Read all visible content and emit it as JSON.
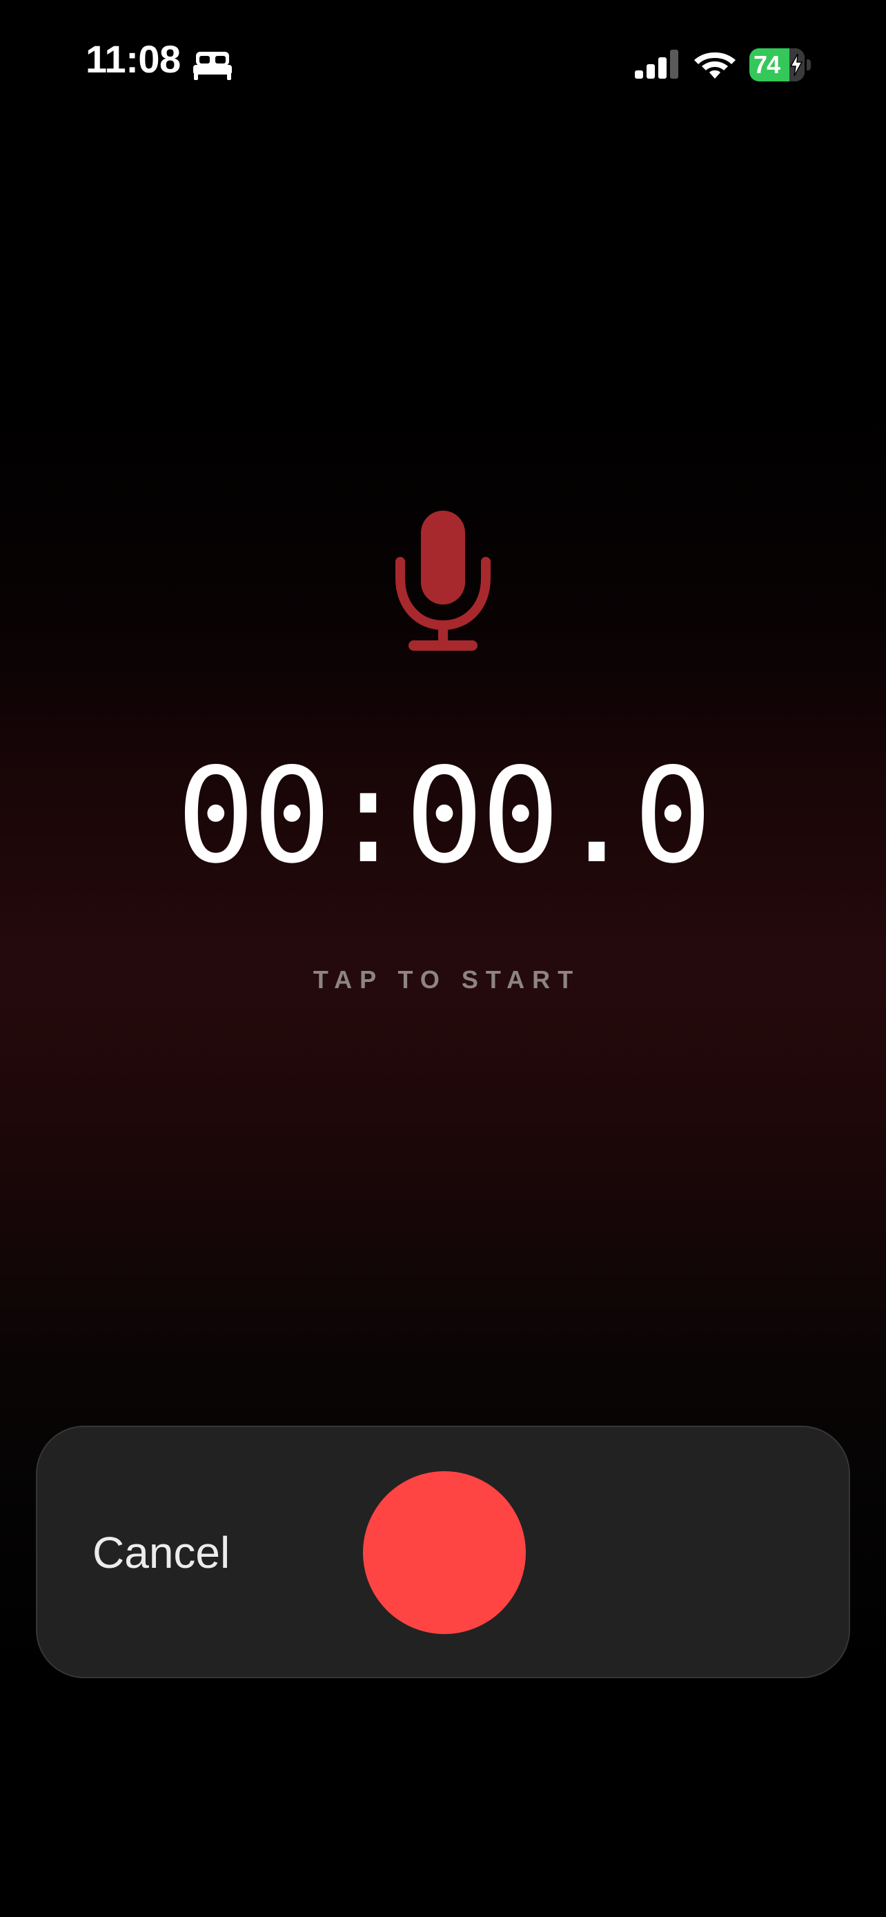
{
  "status_bar": {
    "time": "11:08",
    "focus_icon": "bed-icon",
    "signal_icon": "cellular-signal-icon",
    "wifi_icon": "wifi-icon",
    "battery_level": "74",
    "battery_charging": true,
    "battery_color": "#34c759"
  },
  "recorder": {
    "mic_icon": "microphone-icon",
    "mic_color": "#a7292d",
    "timer": "00:00.0",
    "hint": "TAP TO START"
  },
  "controls": {
    "cancel_label": "Cancel",
    "record_icon": "record-button",
    "record_color": "#ff4444"
  }
}
